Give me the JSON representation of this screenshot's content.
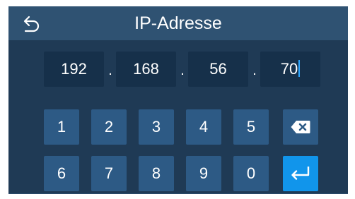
{
  "header": {
    "title": "IP-Adresse",
    "back_icon": "back-arrow-icon"
  },
  "ip": {
    "octets": [
      "192",
      "168",
      "56",
      "70"
    ],
    "separator": "."
  },
  "keypad": {
    "row1": [
      "1",
      "2",
      "3",
      "4",
      "5"
    ],
    "row2": [
      "6",
      "7",
      "8",
      "9",
      "0"
    ],
    "backspace_icon": "backspace-icon",
    "enter_icon": "enter-icon"
  },
  "colors": {
    "background": "#1f3a55",
    "header": "#2f5272",
    "field": "#16304a",
    "key": "#2d5a85",
    "enter_key": "#1195eb",
    "caret": "#2da6ff"
  }
}
